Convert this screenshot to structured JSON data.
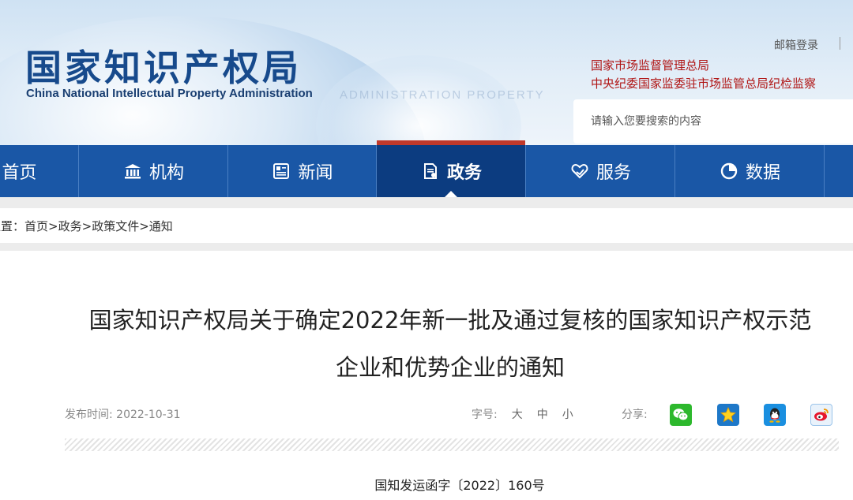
{
  "header": {
    "logo_cn": "国家知识产权局",
    "logo_en": "China National Intellectual Property Administration",
    "watermark": "ADMINISTRATION  PROPERTY",
    "mail_login": "邮箱登录",
    "org_links": [
      "国家市场监督管理总局",
      "中央纪委国家监委驻市场监管总局纪检监察"
    ],
    "search_placeholder": "请输入您要搜索的内容"
  },
  "nav": {
    "items": [
      {
        "label": "首页",
        "icon": "home-icon"
      },
      {
        "label": "机构",
        "icon": "institution-icon"
      },
      {
        "label": "新闻",
        "icon": "newspaper-icon"
      },
      {
        "label": "政务",
        "icon": "document-icon",
        "active": true
      },
      {
        "label": "服务",
        "icon": "heart-hand-icon"
      },
      {
        "label": "数据",
        "icon": "pie-chart-icon"
      }
    ],
    "active_color": "#0c3c80",
    "bar_color": "#1a57a6",
    "accent": "#c0392b"
  },
  "breadcrumb": {
    "prefix": "位置：",
    "items": [
      "首页",
      "政务",
      "政策文件",
      "通知"
    ],
    "separator": ">"
  },
  "article": {
    "title_line1": "国家知识产权局关于确定2022年新一批及通过复核的国家知识产权示范",
    "title_line2": "企业和优势企业的通知",
    "date_label": "发布时间:",
    "date": "2022-10-31",
    "font_size_label": "字号:",
    "font_sizes": [
      "大",
      "中",
      "小"
    ],
    "share_label": "分享:",
    "share_icons": [
      "wechat-icon",
      "qzone-icon",
      "qq-icon",
      "weibo-icon"
    ],
    "doc_number": "国知发运函字〔2022〕160号"
  }
}
